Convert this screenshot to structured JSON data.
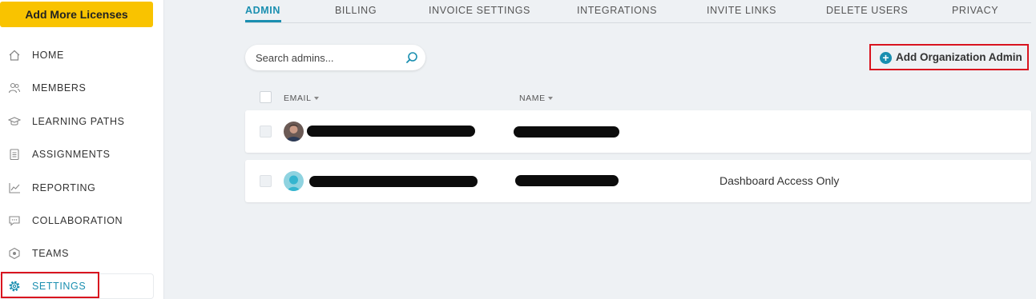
{
  "sidebar": {
    "cta_label": "Add More Licenses",
    "items": [
      {
        "label": "HOME",
        "icon": "home-icon"
      },
      {
        "label": "MEMBERS",
        "icon": "members-icon"
      },
      {
        "label": "LEARNING PATHS",
        "icon": "graduation-cap-icon"
      },
      {
        "label": "ASSIGNMENTS",
        "icon": "assignments-icon"
      },
      {
        "label": "REPORTING",
        "icon": "chart-icon"
      },
      {
        "label": "COLLABORATION",
        "icon": "chat-icon"
      },
      {
        "label": "TEAMS",
        "icon": "teams-icon"
      },
      {
        "label": "SETTINGS",
        "icon": "gear-icon",
        "active": true
      }
    ]
  },
  "tabs": [
    {
      "label": "ADMIN",
      "active": true
    },
    {
      "label": "BILLING"
    },
    {
      "label": "INVOICE SETTINGS"
    },
    {
      "label": "INTEGRATIONS"
    },
    {
      "label": "INVITE LINKS"
    },
    {
      "label": "DELETE USERS"
    },
    {
      "label": "PRIVACY"
    }
  ],
  "search": {
    "placeholder": "Search admins..."
  },
  "add_admin": {
    "label": "Add Organization Admin"
  },
  "table": {
    "columns": {
      "email": "EMAIL",
      "name": "NAME"
    },
    "rows": [
      {
        "email": "",
        "name": "",
        "access": ""
      },
      {
        "email": "",
        "name": "",
        "access": "Dashboard Access Only"
      }
    ]
  },
  "colors": {
    "accent": "#1a8fb0",
    "cta": "#f9c300",
    "highlight": "#d9141f"
  }
}
